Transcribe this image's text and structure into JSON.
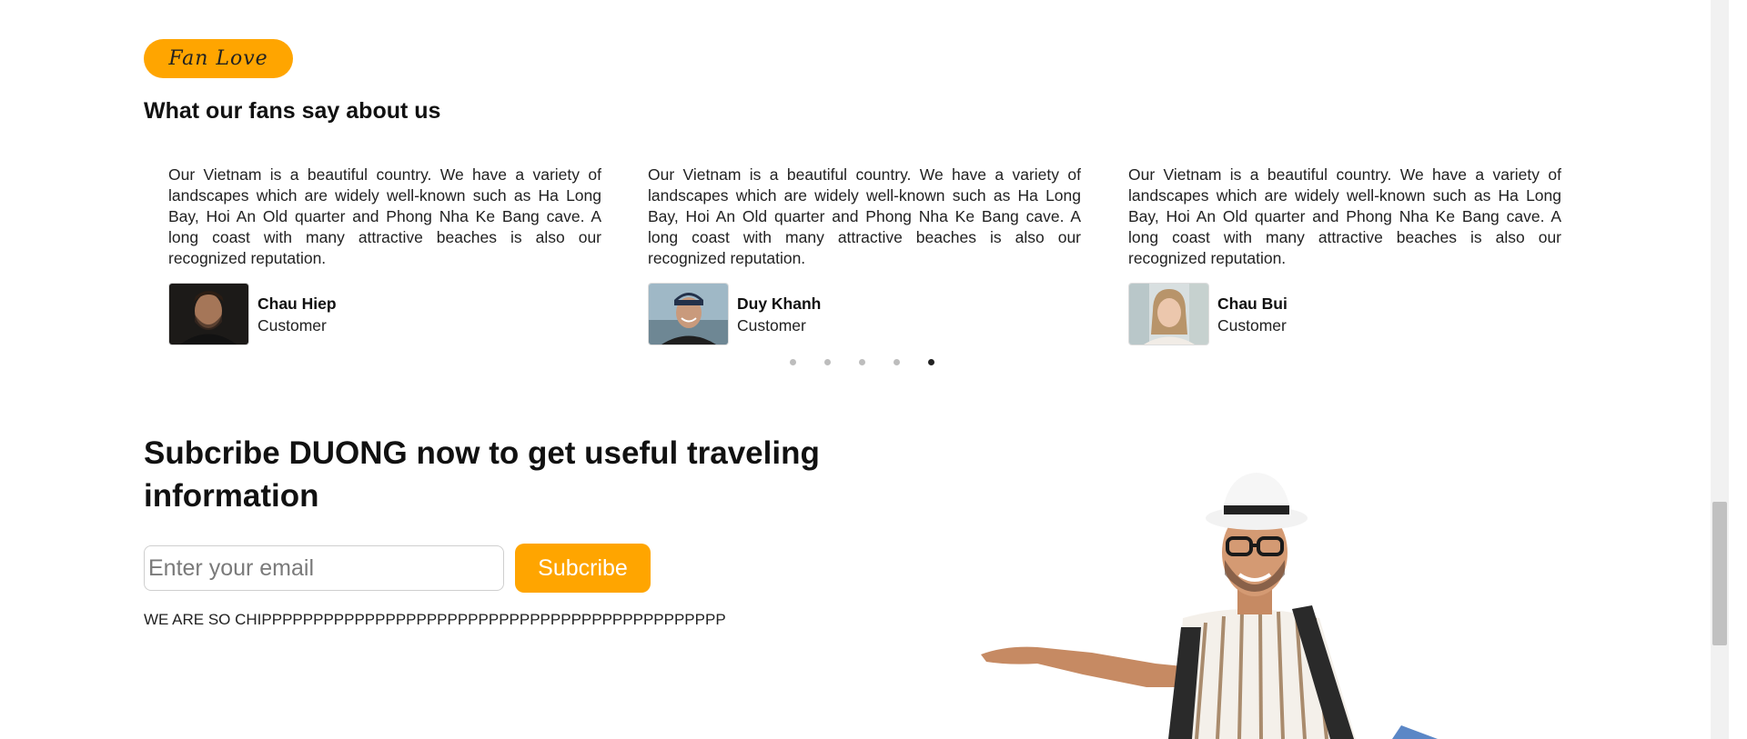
{
  "fan_section": {
    "label": "Fan Love",
    "title": "What our fans say about us"
  },
  "testimonials": [
    {
      "text": "Our Vietnam is a beautiful country. We have a variety of landscapes which are widely well-known such as Ha Long Bay, Hoi An Old quarter and Phong Nha Ke Bang cave. A long coast with many attractive beaches is also our recognized reputation.",
      "name": "Chau Hiep",
      "role": "Customer"
    },
    {
      "text": "Our Vietnam is a beautiful country. We have a variety of landscapes which are widely well-known such as Ha Long Bay, Hoi An Old quarter and Phong Nha Ke Bang cave. A long coast with many attractive beaches is also our recognized reputation.",
      "name": "Duy Khanh",
      "role": "Customer"
    },
    {
      "text": "Our Vietnam is a beautiful country. We have a variety of landscapes which are widely well-known such as Ha Long Bay, Hoi An Old quarter and Phong Nha Ke Bang cave. A long coast with many attractive beaches is also our recognized reputation.",
      "name": "Chau Bui",
      "role": "Customer"
    }
  ],
  "carousel": {
    "dot_count": 5,
    "active_dot": 5
  },
  "subscribe": {
    "title": "Subcribe DUONG now to get useful traveling information",
    "email_placeholder": "Enter your email",
    "email_value": "",
    "button_label": "Subcribe",
    "tagline": "WE ARE SO CHIPPPPPPPPPPPPPPPPPPPPPPPPPPPPPPPPPPPPPPPPPPPPP"
  },
  "colors": {
    "accent": "#ffa500",
    "dot_inactive": "#bdbdbd",
    "dot_active": "#222222"
  }
}
